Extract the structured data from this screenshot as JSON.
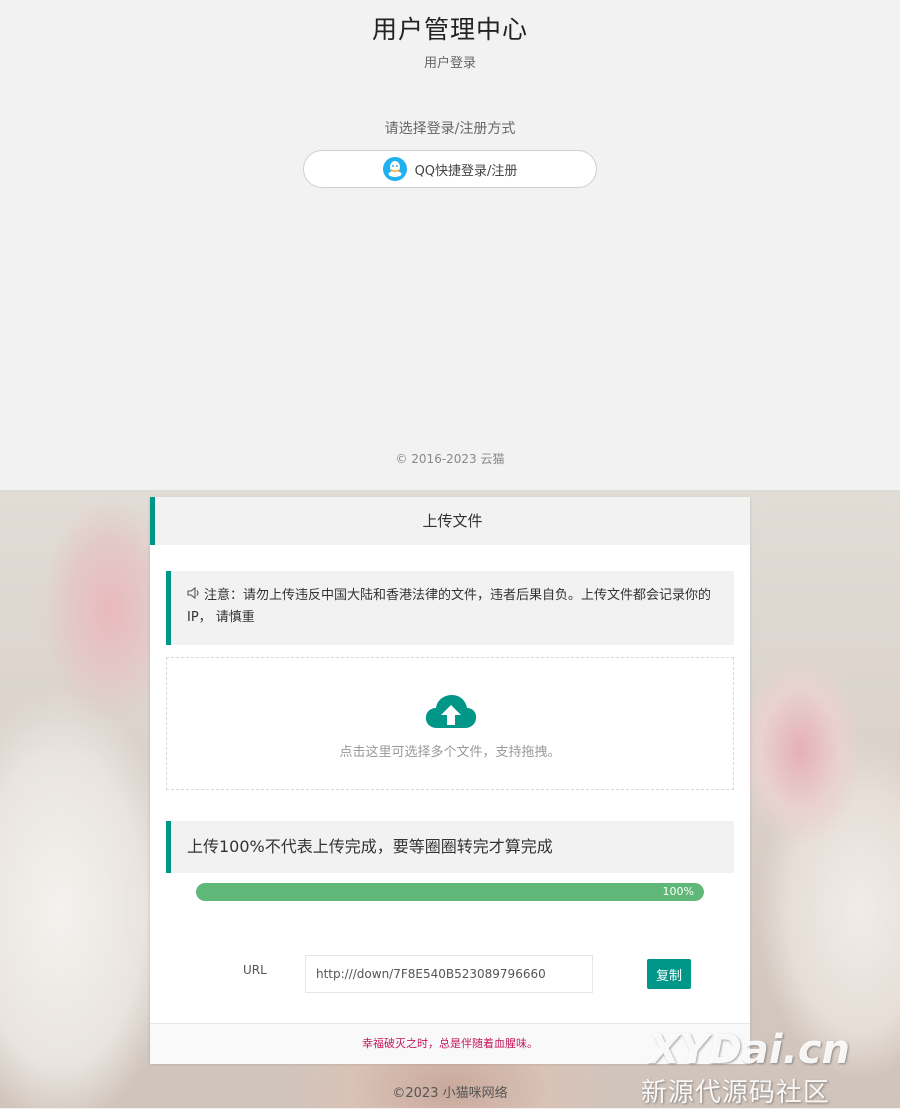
{
  "login": {
    "title": "用户管理中心",
    "subtitle": "用户登录",
    "choose_method": "请选择登录/注册方式",
    "qq_button_label": "QQ快捷登录/注册",
    "copyright": "© 2016-2023 云猫"
  },
  "upload": {
    "header": "上传文件",
    "notice": "注意：请勿上传违反中国大陆和香港法律的文件，违者后果自负。上传文件都会记录你的IP， 请慎重",
    "dropzone_hint": "点击这里可选择多个文件，支持拖拽。",
    "warning": "上传100%不代表上传完成，要等圈圈转完才算完成",
    "progress": {
      "value": 1.0,
      "label": "100%"
    },
    "url_label": "URL",
    "url_value": "http:///down/7F8E540B523089796660",
    "copy_button": "复制",
    "footer_quote": "幸福破灭之时，总是伴随着血腥味。"
  },
  "page_footer": "©2023 小猫咪网络",
  "watermark": {
    "main": "XYDai.cn",
    "sub": "新源代源码社区"
  },
  "colors": {
    "accent": "#009688",
    "progress": "#5fb878",
    "qq": "#1fb0ef",
    "quote": "#c2185b"
  },
  "icons": [
    "qq-icon",
    "speaker-icon",
    "cloud-upload-icon"
  ]
}
